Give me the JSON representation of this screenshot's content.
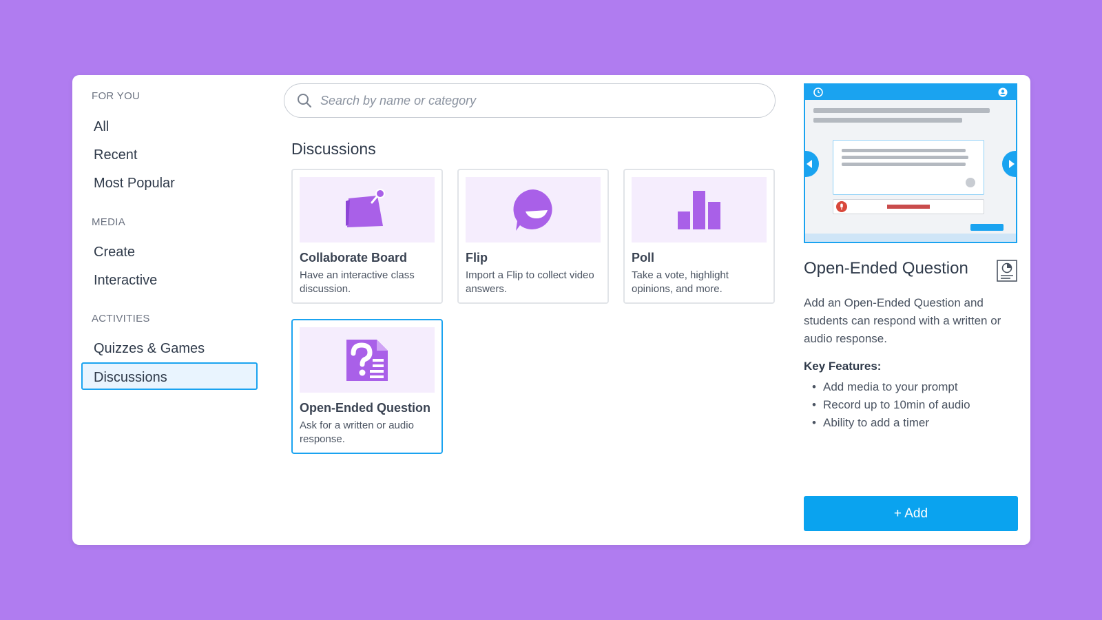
{
  "sidebar": {
    "sections": [
      {
        "title": "FOR YOU",
        "items": [
          "All",
          "Recent",
          "Most Popular"
        ]
      },
      {
        "title": "MEDIA",
        "items": [
          "Create",
          "Interactive"
        ]
      },
      {
        "title": "ACTIVITIES",
        "items": [
          "Quizzes & Games",
          "Discussions"
        ]
      }
    ],
    "active_item": "Discussions"
  },
  "search": {
    "placeholder": "Search by name or category",
    "value": ""
  },
  "main": {
    "heading": "Discussions",
    "cards": [
      {
        "title": "Collaborate Board",
        "description": "Have an interactive class discussion.",
        "icon": "sticky-note-pin-icon"
      },
      {
        "title": "Flip",
        "description": "Import a Flip to collect video answers.",
        "icon": "flip-face-icon"
      },
      {
        "title": "Poll",
        "description": "Take a vote, highlight opinions, and more.",
        "icon": "bar-chart-icon"
      },
      {
        "title": "Open-Ended Question",
        "description": "Ask for a written or audio response.",
        "icon": "question-document-icon",
        "selected": true
      }
    ]
  },
  "details": {
    "title": "Open-Ended Question",
    "description": "Add an Open-Ended Question and students can respond with a written or audio response.",
    "key_features_label": "Key Features:",
    "features": [
      "Add media to your prompt",
      "Record up to 10min of audio",
      "Ability to add a timer"
    ],
    "add_label": "+ Add"
  },
  "colors": {
    "background": "#b07cf0",
    "accent": "#1aa3f0",
    "icon_purple": "#a960e8",
    "thumb_bg": "#f5edfd"
  }
}
